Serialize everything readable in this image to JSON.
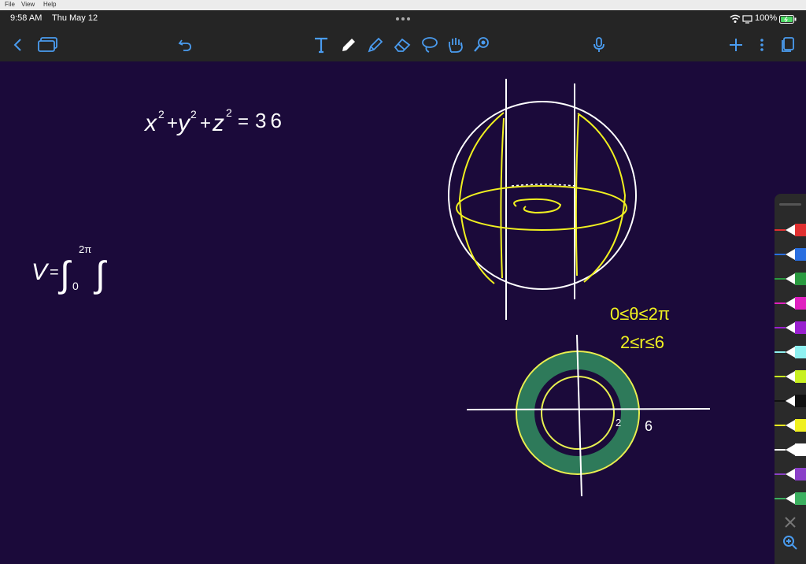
{
  "menu": {
    "file": "File",
    "view": "View",
    "help": "Help"
  },
  "status": {
    "time": "9:58 AM",
    "date": "Thu May 12",
    "battery": "100%"
  },
  "toolbar": {
    "tools": [
      "back-icon",
      "pages-icon",
      "undo-icon",
      "text-tool-icon",
      "pen-tool-icon",
      "highlighter-tool-icon",
      "eraser-tool-icon",
      "lasso-tool-icon",
      "hand-tool-icon",
      "laser-pointer-icon",
      "microphone-icon",
      "add-icon",
      "more-icon",
      "page-view-icon"
    ]
  },
  "notes": {
    "equation": {
      "x": "x",
      "x_exp": "2",
      "plus1": "+",
      "y": "y",
      "y_exp": "2",
      "plus2": "+",
      "z": "z",
      "z_exp": "2",
      "eq": "=",
      "value": "36"
    },
    "volume": {
      "v": "V",
      "eq": "=",
      "integral": "∫",
      "lower": "0",
      "upper": "2π",
      "integral2": "∫"
    },
    "bounds": {
      "theta": "0≤θ≤2π",
      "r": "2≤r≤6"
    },
    "inner_radius": "2",
    "outer_radius": "6"
  },
  "palette": {
    "pens": [
      {
        "name": "red-pen",
        "color": "#e03030"
      },
      {
        "name": "blue-pen",
        "color": "#2a6fe0"
      },
      {
        "name": "green-pen",
        "color": "#2a9a40"
      },
      {
        "name": "magenta-pen",
        "color": "#e020c0"
      },
      {
        "name": "purple-pen",
        "color": "#9a20d0"
      },
      {
        "name": "cyan-pen",
        "color": "#8ef0f0"
      },
      {
        "name": "lime-pen",
        "color": "#c8f020"
      },
      {
        "name": "black-pen",
        "color": "#111111"
      },
      {
        "name": "yellow-pen",
        "color": "#f0f020"
      },
      {
        "name": "white-pen",
        "color": "#ffffff"
      },
      {
        "name": "violet-highlighter",
        "color": "#8a40c8"
      },
      {
        "name": "green-highlighter",
        "color": "#3cb060"
      }
    ]
  }
}
